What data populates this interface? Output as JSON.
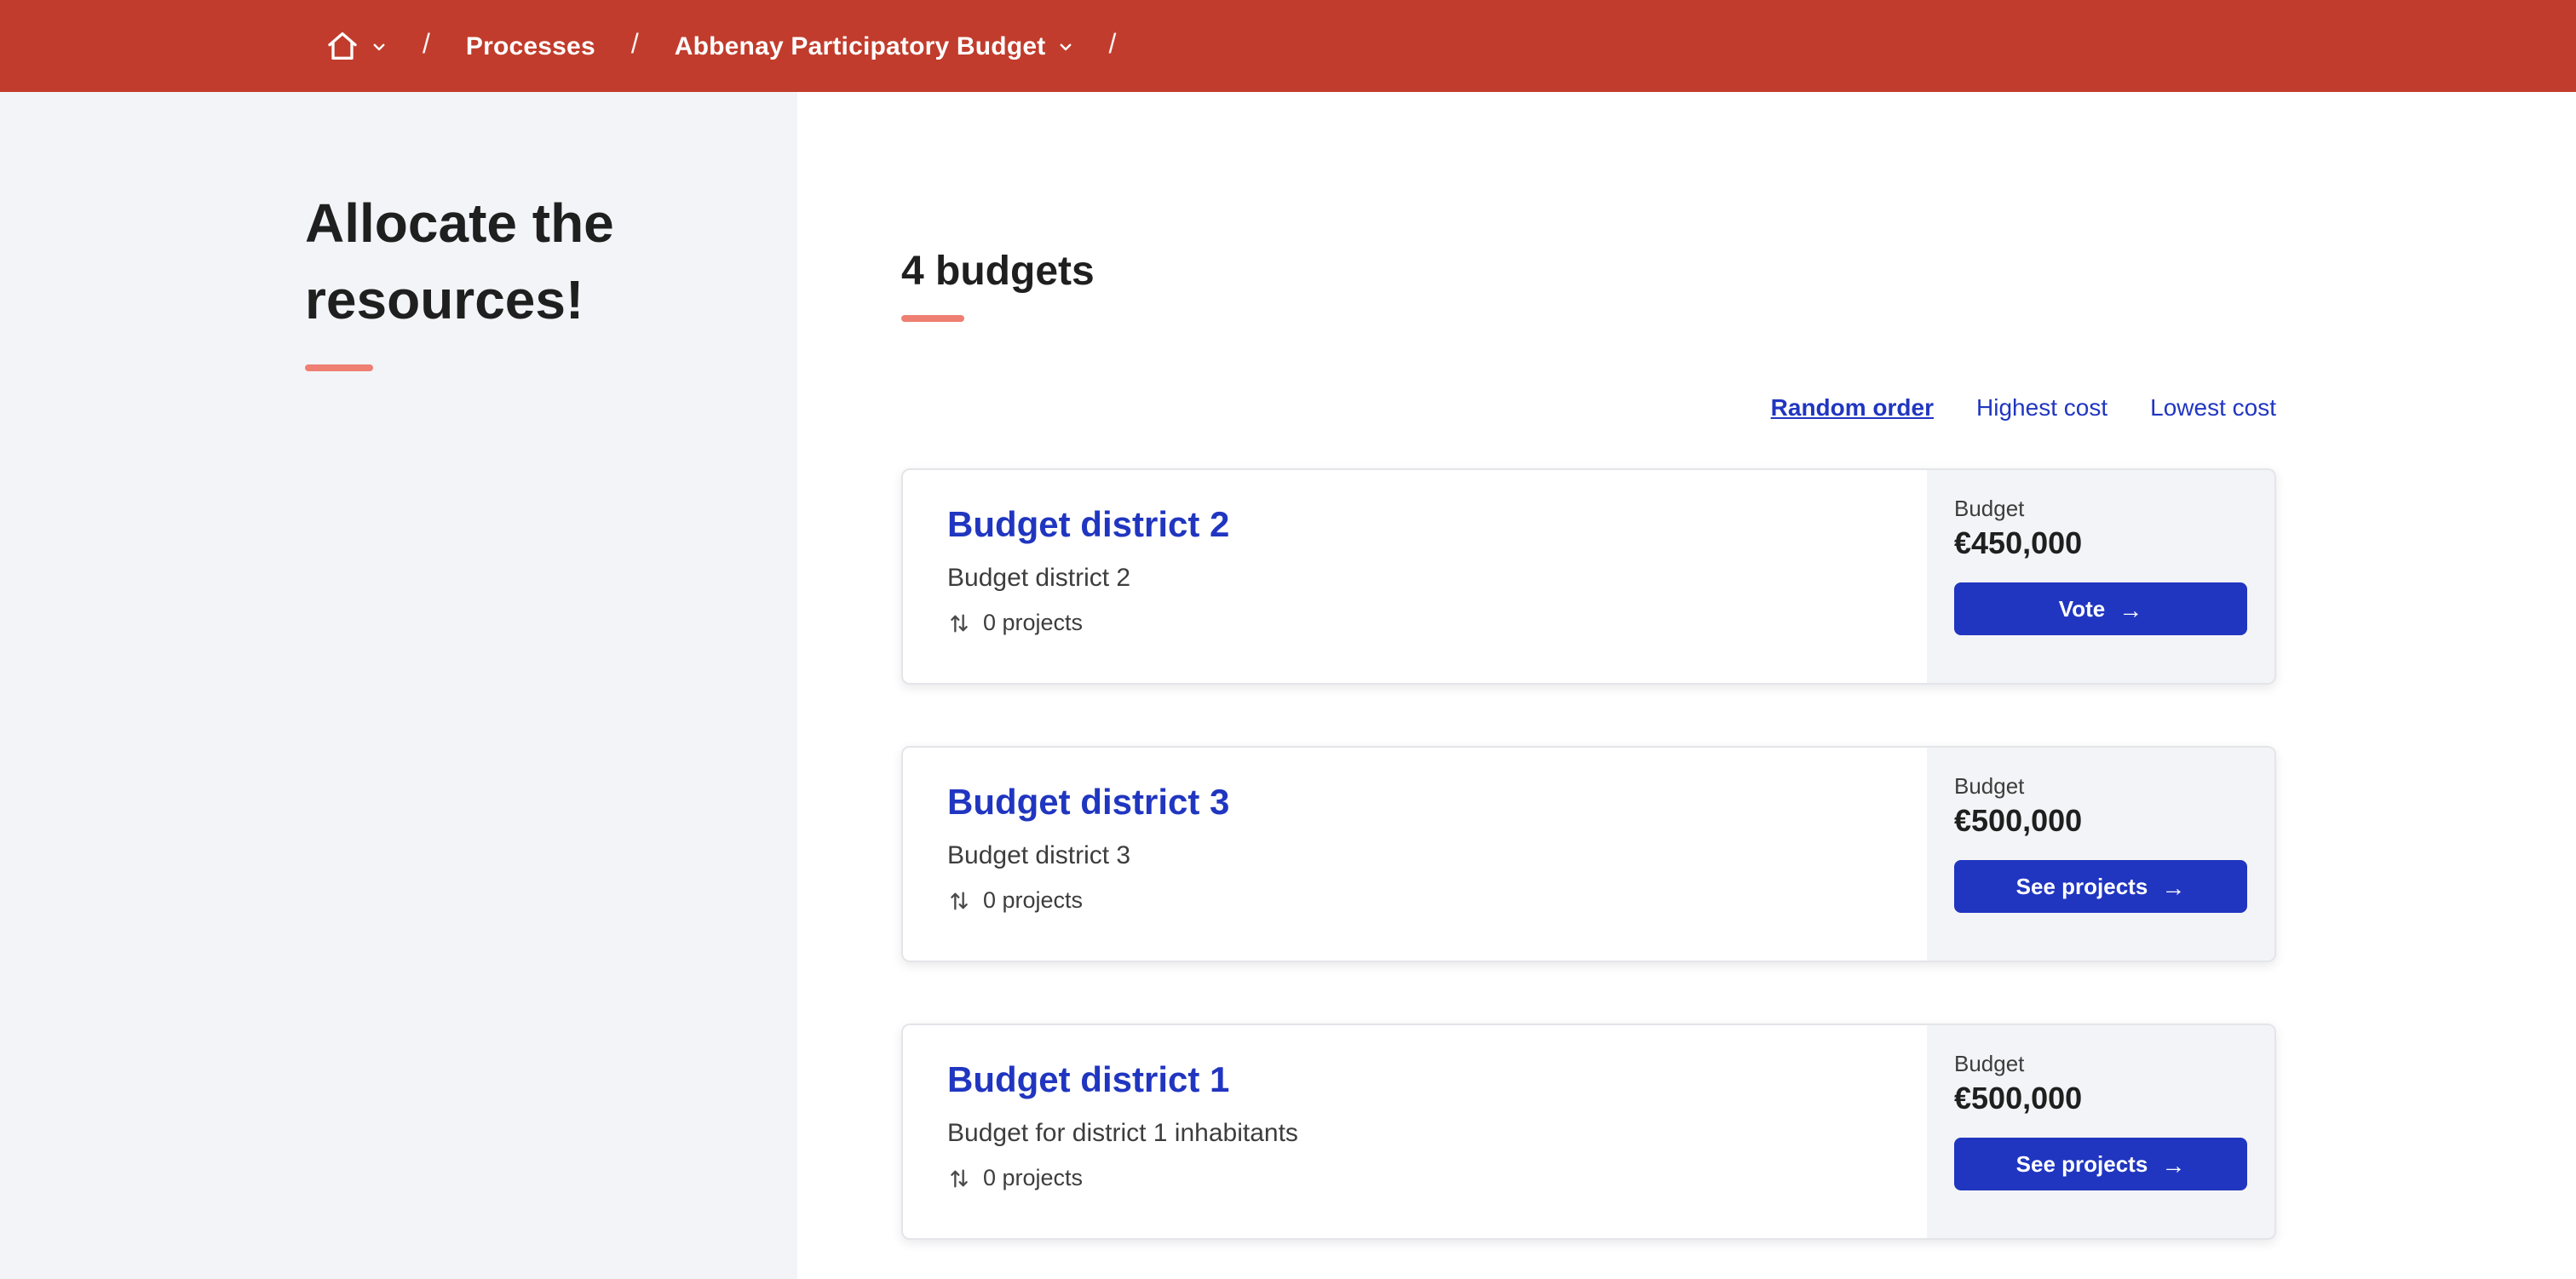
{
  "topbar": {
    "breadcrumb": {
      "separator": "/",
      "items": [
        {
          "label": "Processes"
        },
        {
          "label": "Abbenay Participatory Budget"
        }
      ]
    }
  },
  "sidebar": {
    "title": "Allocate the resources!"
  },
  "main": {
    "heading": "4 budgets",
    "sort": {
      "options": [
        {
          "label": "Random order",
          "active": true
        },
        {
          "label": "Highest cost",
          "active": false
        },
        {
          "label": "Lowest cost",
          "active": false
        }
      ]
    },
    "cards": [
      {
        "title": "Budget district 2",
        "description": "Budget district 2",
        "projects": "0 projects",
        "budget_label": "Budget",
        "amount": "€450,000",
        "button": "Vote"
      },
      {
        "title": "Budget district 3",
        "description": "Budget district 3",
        "projects": "0 projects",
        "budget_label": "Budget",
        "amount": "€500,000",
        "button": "See projects"
      },
      {
        "title": "Budget district 1",
        "description": "Budget for district 1 inhabitants",
        "projects": "0 projects",
        "budget_label": "Budget",
        "amount": "€500,000",
        "button": "See projects"
      }
    ]
  },
  "icons": {
    "home": "home-outline",
    "chevron_down": "chevron-down",
    "swap_vertical": "swap-vertical",
    "arrow_right": "→"
  },
  "colors": {
    "topbar_red": "#c13c2c",
    "primary_blue": "#2036c0",
    "accent_salmon": "#ee7f72",
    "panel_gray": "#f3f4f7"
  }
}
